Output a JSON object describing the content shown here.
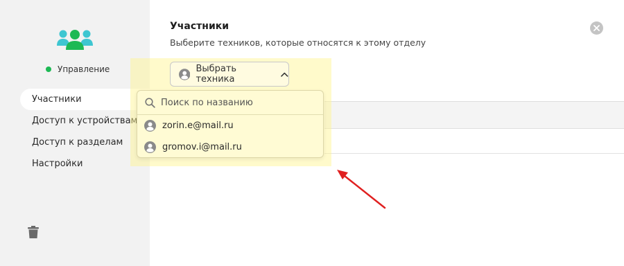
{
  "sidebar": {
    "group_icon": "users-group-icon",
    "status_label": "Управление",
    "status_color": "#1db954",
    "items": [
      {
        "label": "Участники",
        "active": true
      },
      {
        "label": "Доступ к устройствам",
        "active": false
      },
      {
        "label": "Доступ к разделам",
        "active": false
      },
      {
        "label": "Настройки",
        "active": false
      }
    ],
    "trash_icon": "trash-icon"
  },
  "main": {
    "title": "Участники",
    "subtitle": "Выберите техников, которые относятся к этому отделу",
    "select_label": "Выбрать техника",
    "dropdown": {
      "search_placeholder": "Поиск по названию",
      "options": [
        "zorin.e@mail.ru",
        "gromov.i@mail.ru"
      ]
    }
  },
  "colors": {
    "accent_green": "#1db954",
    "group_teal": "#3ec6d1",
    "highlight": "#fff58c",
    "arrow": "#e02020"
  }
}
